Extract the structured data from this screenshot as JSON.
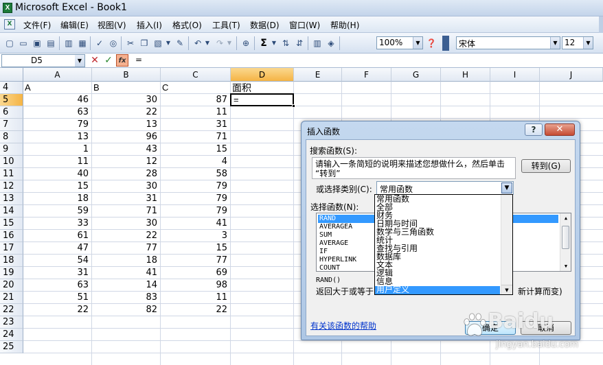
{
  "window": {
    "title": "Microsoft Excel - Book1",
    "app_icon": "excel-icon"
  },
  "menu": [
    "文件(F)",
    "编辑(E)",
    "视图(V)",
    "插入(I)",
    "格式(O)",
    "工具(T)",
    "数据(D)",
    "窗口(W)",
    "帮助(H)"
  ],
  "toolbar": {
    "zoom": "100%",
    "font": "宋体",
    "size": "12"
  },
  "formula_bar": {
    "name_box": "D5",
    "content": "="
  },
  "columns": [
    "A",
    "B",
    "C",
    "D",
    "E",
    "F",
    "G",
    "H",
    "I",
    "J"
  ],
  "rows": [
    "4",
    "5",
    "6",
    "7",
    "8",
    "9",
    "10",
    "11",
    "12",
    "13",
    "14",
    "15",
    "16",
    "17",
    "18",
    "19",
    "20",
    "21",
    "22",
    "23",
    "24",
    "25"
  ],
  "header_row": {
    "A": "A",
    "B": "B",
    "C": "C",
    "D": "面积"
  },
  "active_cell_value": "=",
  "data": [
    [
      46,
      30,
      87
    ],
    [
      63,
      22,
      11
    ],
    [
      79,
      13,
      31
    ],
    [
      13,
      96,
      71
    ],
    [
      1,
      43,
      15
    ],
    [
      11,
      12,
      4
    ],
    [
      40,
      28,
      58
    ],
    [
      15,
      30,
      79
    ],
    [
      18,
      31,
      79
    ],
    [
      59,
      71,
      79
    ],
    [
      33,
      30,
      41
    ],
    [
      61,
      22,
      3
    ],
    [
      47,
      77,
      15
    ],
    [
      54,
      18,
      77
    ],
    [
      31,
      41,
      69
    ],
    [
      63,
      14,
      98
    ],
    [
      51,
      83,
      11
    ],
    [
      22,
      82,
      22
    ]
  ],
  "dialog": {
    "title": "插入函数",
    "help_btn": "?",
    "close_btn": "✕",
    "search_label": "搜索函数(S):",
    "search_text_1": "请输入一条简短的说明来描述您想做什么，然后单击",
    "search_text_2": "“转到”",
    "goto_btn": "转到(G)",
    "category_label": "或选择类别(C):",
    "category_value": "常用函数",
    "select_label": "选择函数(N):",
    "functions": [
      "RAND",
      "AVERAGEA",
      "SUM",
      "AVERAGE",
      "IF",
      "HYPERLINK",
      "COUNT"
    ],
    "signature": "RAND()",
    "description": "返回大于或等于",
    "description_tail": "新计算而变)",
    "help_link": "有关该函数的帮助",
    "ok_btn": "确定",
    "cancel_btn": "取消"
  },
  "category_options": [
    "常用函数",
    "全部",
    "财务",
    "日期与时间",
    "数学与三角函数",
    "统计",
    "查找与引用",
    "数据库",
    "文本",
    "逻辑",
    "信息",
    "用户定义"
  ],
  "watermark": {
    "text": "Baidu",
    "url": "jingyan.baidu.com"
  }
}
